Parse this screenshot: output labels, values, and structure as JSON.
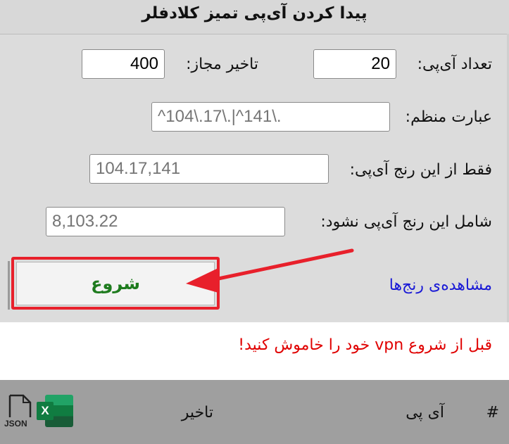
{
  "header": {
    "title": "پیدا کردن آی‌پی تمیز کلادفلر"
  },
  "form": {
    "ip_count_label": "تعداد آی‌پی:",
    "ip_count_value": "20",
    "allowed_delay_label": "تاخیر مجاز:",
    "allowed_delay_value": "400",
    "regex_label": "عبارت منظم:",
    "regex_placeholder": "^104\\.17\\.|^141\\.",
    "only_range_label": "فقط از این رنج آی‌پی:",
    "only_range_placeholder": "104.17,141",
    "exclude_range_label": "شامل این رنج آی‌پی نشود:",
    "exclude_range_placeholder": "8,103.22"
  },
  "actions": {
    "start_label": "شروع",
    "view_ranges_link": "مشاهده‌ی رنج‌ها"
  },
  "notice": {
    "text": "قبل از شروع vpn خود را خاموش کنید!"
  },
  "results_table": {
    "columns": [
      "#",
      "آی پی",
      "تاخیر"
    ]
  },
  "export_icons": {
    "json_label": "JSON",
    "excel_letter": "X"
  },
  "colors": {
    "highlight": "#e8202b",
    "start_text": "#1e7b1e",
    "link": "#1919d6",
    "warning": "#e00000"
  }
}
